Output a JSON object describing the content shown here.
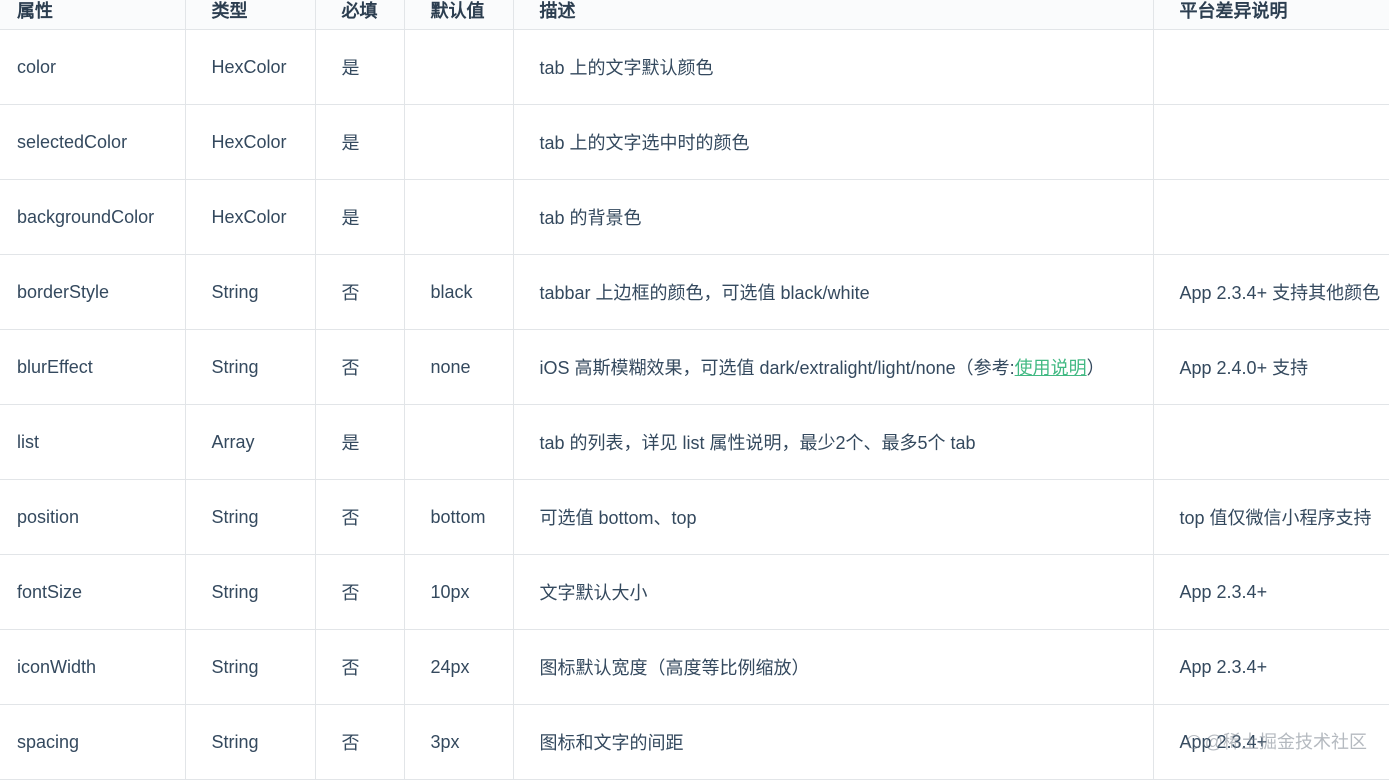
{
  "headers": [
    "属性",
    "类型",
    "必填",
    "默认值",
    "描述",
    "平台差异说明"
  ],
  "rows": [
    {
      "name": "color",
      "type": "HexColor",
      "required": "是",
      "default": "",
      "desc": "tab 上的文字默认颜色",
      "desc_link": "",
      "desc_suffix": "",
      "platform": ""
    },
    {
      "name": "selectedColor",
      "type": "HexColor",
      "required": "是",
      "default": "",
      "desc": "tab 上的文字选中时的颜色",
      "desc_link": "",
      "desc_suffix": "",
      "platform": ""
    },
    {
      "name": "backgroundColor",
      "type": "HexColor",
      "required": "是",
      "default": "",
      "desc": "tab 的背景色",
      "desc_link": "",
      "desc_suffix": "",
      "platform": ""
    },
    {
      "name": "borderStyle",
      "type": "String",
      "required": "否",
      "default": "black",
      "desc": "tabbar 上边框的颜色，可选值 black/white",
      "desc_link": "",
      "desc_suffix": "",
      "platform": "App 2.3.4+ 支持其他颜色"
    },
    {
      "name": "blurEffect",
      "type": "String",
      "required": "否",
      "default": "none",
      "desc": "iOS 高斯模糊效果，可选值 dark/extralight/light/none（参考:",
      "desc_link": "使用说明",
      "desc_suffix": "）",
      "platform": "App 2.4.0+ 支持"
    },
    {
      "name": "list",
      "type": "Array",
      "required": "是",
      "default": "",
      "desc": "tab 的列表，详见 list 属性说明，最少2个、最多5个 tab",
      "desc_link": "",
      "desc_suffix": "",
      "platform": ""
    },
    {
      "name": "position",
      "type": "String",
      "required": "否",
      "default": "bottom",
      "desc": "可选值 bottom、top",
      "desc_link": "",
      "desc_suffix": "",
      "platform": "top 值仅微信小程序支持"
    },
    {
      "name": "fontSize",
      "type": "String",
      "required": "否",
      "default": "10px",
      "desc": "文字默认大小",
      "desc_link": "",
      "desc_suffix": "",
      "platform": "App 2.3.4+"
    },
    {
      "name": "iconWidth",
      "type": "String",
      "required": "否",
      "default": "24px",
      "desc": "图标默认宽度（高度等比例缩放）",
      "desc_link": "",
      "desc_suffix": "",
      "platform": "App 2.3.4+"
    },
    {
      "name": "spacing",
      "type": "String",
      "required": "否",
      "default": "3px",
      "desc": "图标和文字的间距",
      "desc_link": "",
      "desc_suffix": "",
      "platform": "App 2.3.4+"
    }
  ],
  "watermark": "@稀土掘金技术社区",
  "colors": {
    "link": "#42b983",
    "text": "#34495e",
    "border": "#e2e5e8"
  }
}
